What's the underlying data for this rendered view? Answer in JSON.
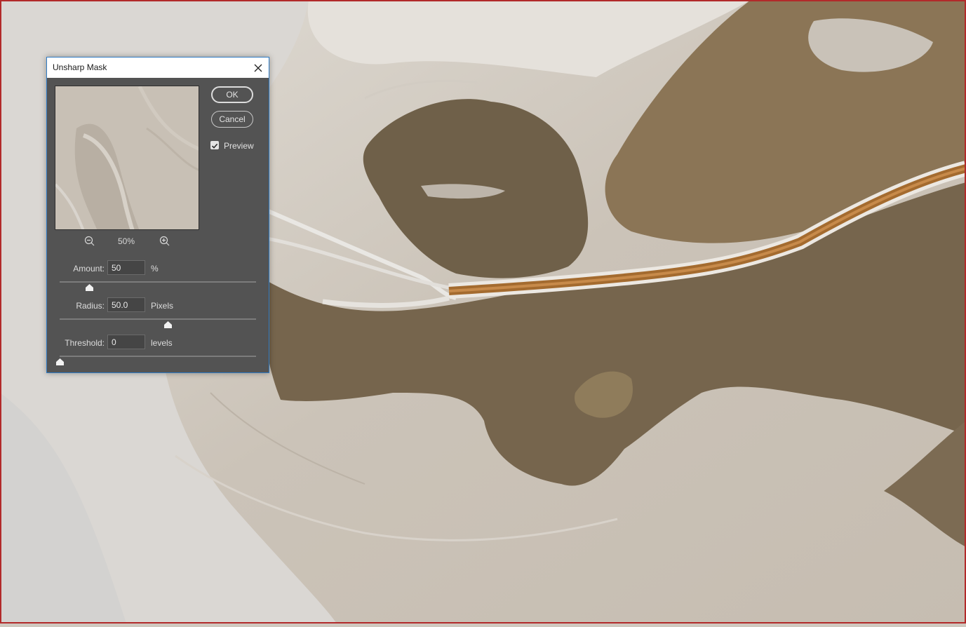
{
  "dialog": {
    "title": "Unsharp Mask",
    "buttons": {
      "ok": "OK",
      "cancel": "Cancel"
    },
    "preview_checkbox": {
      "label": "Preview",
      "checked": true
    },
    "zoom": {
      "value": "50%"
    },
    "params": {
      "amount": {
        "label": "Amount:",
        "value": "50",
        "unit": "%",
        "slider": 0.15
      },
      "radius": {
        "label": "Radius:",
        "value": "50.0",
        "unit": "Pixels",
        "slider": 0.55
      },
      "threshold": {
        "label": "Threshold:",
        "value": "0",
        "unit": "levels",
        "slider": 0.0
      }
    }
  },
  "icons": {
    "close": "close-icon",
    "zoom_out": "zoom-out-icon",
    "zoom_in": "zoom-in-icon",
    "checkmark": "checkmark-icon"
  },
  "colors": {
    "dialog_bg": "#535353",
    "accent_border": "#2f7bc4",
    "window_frame": "#b22a2a"
  }
}
